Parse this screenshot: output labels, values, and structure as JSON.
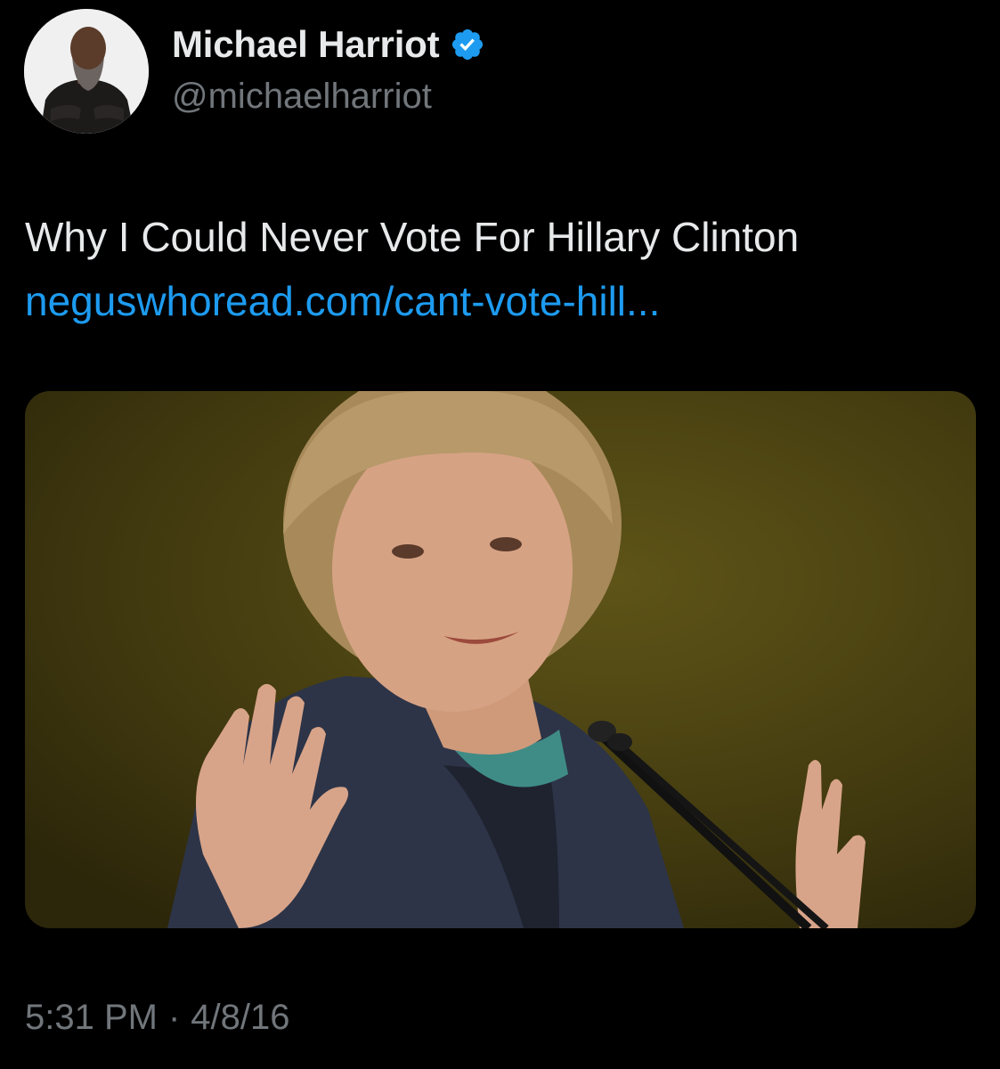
{
  "tweet": {
    "author": {
      "display_name": "Michael Harriot",
      "handle": "@michaelharriot",
      "verified": true,
      "verified_color": "#1d9bf0"
    },
    "text": "Why I Could Never Vote For Hillary Clinton",
    "link_text": "neguswhoread.com/cant-vote-hill...",
    "media": {
      "type": "photo",
      "background_color": "#4a4212"
    },
    "time": "5:31 PM",
    "separator": "·",
    "date": "4/8/16"
  },
  "colors": {
    "background": "#000000",
    "primary_text": "#e7e9ea",
    "secondary_text": "#71767b",
    "link": "#1d9bf0"
  }
}
